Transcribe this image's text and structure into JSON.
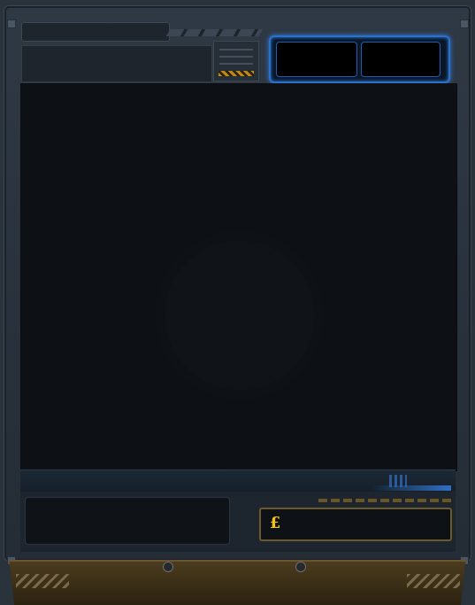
{
  "top_bar": {
    "title": ""
  },
  "resources": {
    "left_value": "",
    "right_value": ""
  },
  "bottom": {
    "name": "",
    "currency_symbol": "£",
    "currency_value": ""
  },
  "colors": {
    "frame": "#2a323b",
    "screen": "#0d1014",
    "accent_blue": "#2e7fe4",
    "accent_gold": "#f2c218",
    "base_bronze": "#4b3c1e"
  }
}
